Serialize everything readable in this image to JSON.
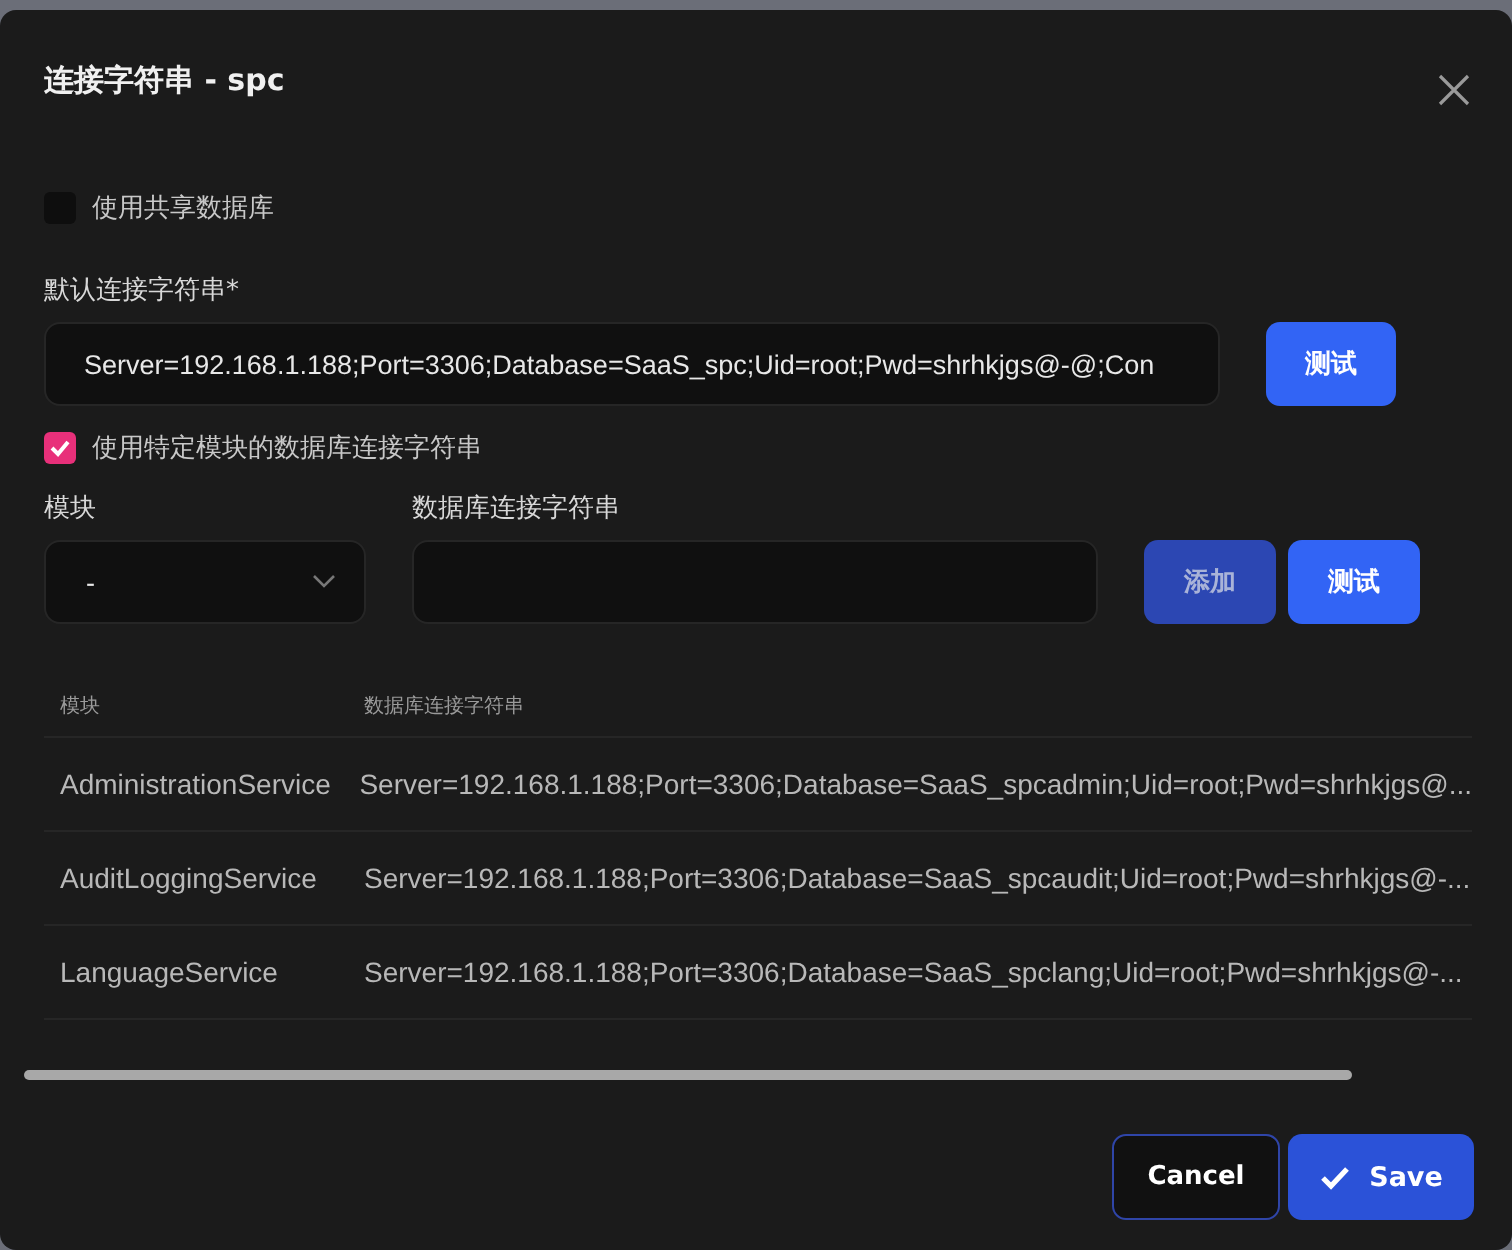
{
  "dialog": {
    "title": "连接字符串 - spc"
  },
  "shared_database": {
    "label": "使用共享数据库",
    "checked": false
  },
  "default_connection": {
    "label": "默认连接字符串*",
    "value": "Server=192.168.1.188;Port=3306;Database=SaaS_spc;Uid=root;Pwd=shrhkjgs@-@;Con",
    "test_button": "测试"
  },
  "module_specific": {
    "label": "使用特定模块的数据库连接字符串",
    "checked": true
  },
  "module_field": {
    "label": "模块",
    "value": "-"
  },
  "module_connection_field": {
    "label": "数据库连接字符串"
  },
  "action_buttons": [
    {
      "label": "添加",
      "disabled": true
    },
    {
      "label": "测试",
      "disabled": false
    }
  ],
  "table": {
    "columns": [
      "模块",
      "数据库连接字符串"
    ],
    "rows": [
      [
        "AdministrationService",
        "Server=192.168.1.188;Port=3306;Database=SaaS_spcadmin;Uid=root;Pwd=shrhkjgs@..."
      ],
      [
        "AuditLoggingService",
        "Server=192.168.1.188;Port=3306;Database=SaaS_spcaudit;Uid=root;Pwd=shrhkjgs@-..."
      ],
      [
        "LanguageService",
        "Server=192.168.1.188;Port=3306;Database=SaaS_spclang;Uid=root;Pwd=shrhkjgs@-..."
      ]
    ]
  },
  "footer": {
    "cancel": "Cancel",
    "save": "Save"
  }
}
